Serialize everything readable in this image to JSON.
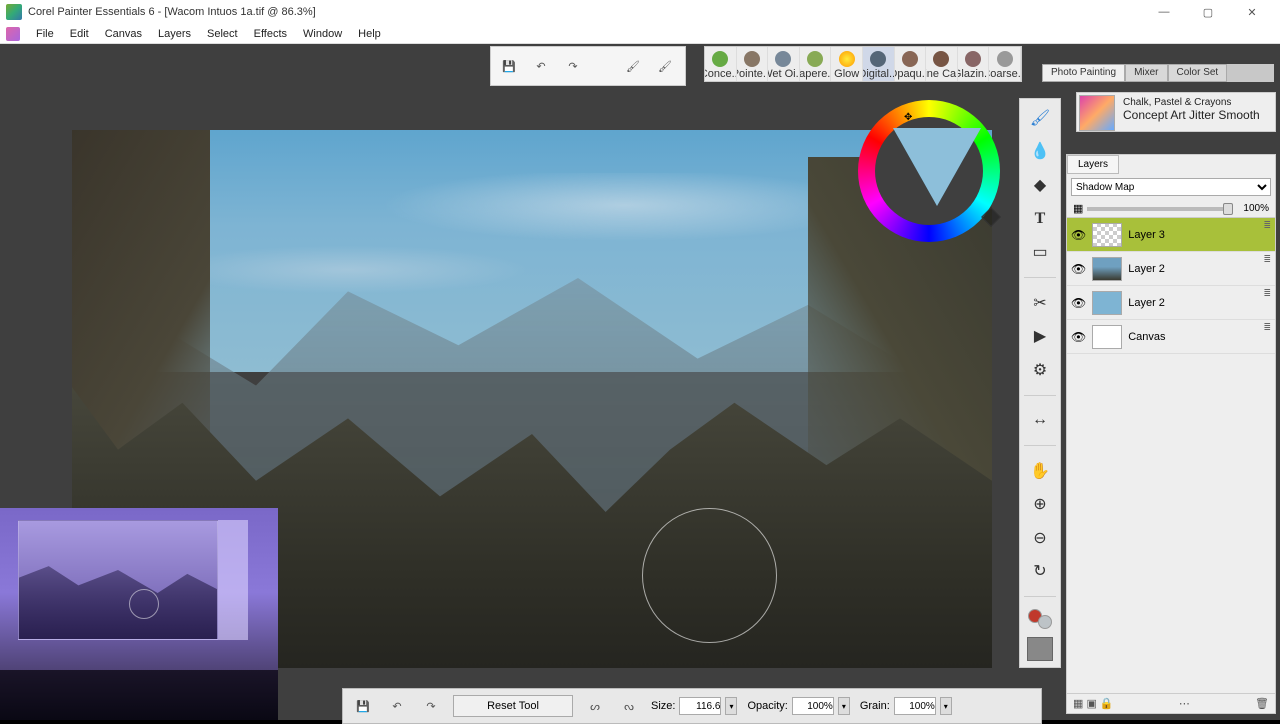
{
  "titlebar": {
    "title": "Corel Painter Essentials 6 - [Wacom Intuos 1a.tif @ 86.3%]"
  },
  "menu": {
    "items": [
      "File",
      "Edit",
      "Canvas",
      "Layers",
      "Select",
      "Effects",
      "Window",
      "Help"
    ]
  },
  "toolbar_top": {
    "save": "💾",
    "undo": "↶",
    "redo": "↷",
    "brush1": "🖌",
    "brush2": "🖌"
  },
  "brushes": {
    "items": [
      "Conce...",
      "Pointe...",
      "Wet Oi...",
      "Tapere...",
      "Glow",
      "Digital...",
      "Opaqu...",
      "Fine Ca...",
      "Glazin...",
      "Coarse..."
    ]
  },
  "panel_tabs": {
    "items": [
      "Photo Painting",
      "Mixer",
      "Color Set"
    ],
    "active": 0
  },
  "brush_info": {
    "category": "Chalk, Pastel & Crayons",
    "name": "Concept Art Jitter Smooth"
  },
  "layers": {
    "tab": "Layers",
    "blend": "Shadow Map",
    "opacity": "100%",
    "items": [
      {
        "name": "Layer 3",
        "selected": true,
        "thumb": "transparent"
      },
      {
        "name": "Layer 2",
        "selected": false,
        "thumb": "painting"
      },
      {
        "name": "Layer 2",
        "selected": false,
        "thumb": "sky"
      },
      {
        "name": "Canvas",
        "selected": false,
        "thumb": "white"
      }
    ]
  },
  "bottom": {
    "reset": "Reset Tool",
    "size_label": "Size:",
    "size_value": "116.6",
    "opacity_label": "Opacity:",
    "opacity_value": "100%",
    "grain_label": "Grain:",
    "grain_value": "100%"
  },
  "tools": {
    "brush": "🖌",
    "dropper": "💧",
    "bucket": "◆",
    "text": "T",
    "eraser": "▭",
    "crop": "✂",
    "arrow": "▶",
    "adjust": "⚙",
    "mirror": "↔",
    "hand": "✋",
    "zoomin": "⊕",
    "zoomout": "⊖",
    "rotate": "↻"
  }
}
